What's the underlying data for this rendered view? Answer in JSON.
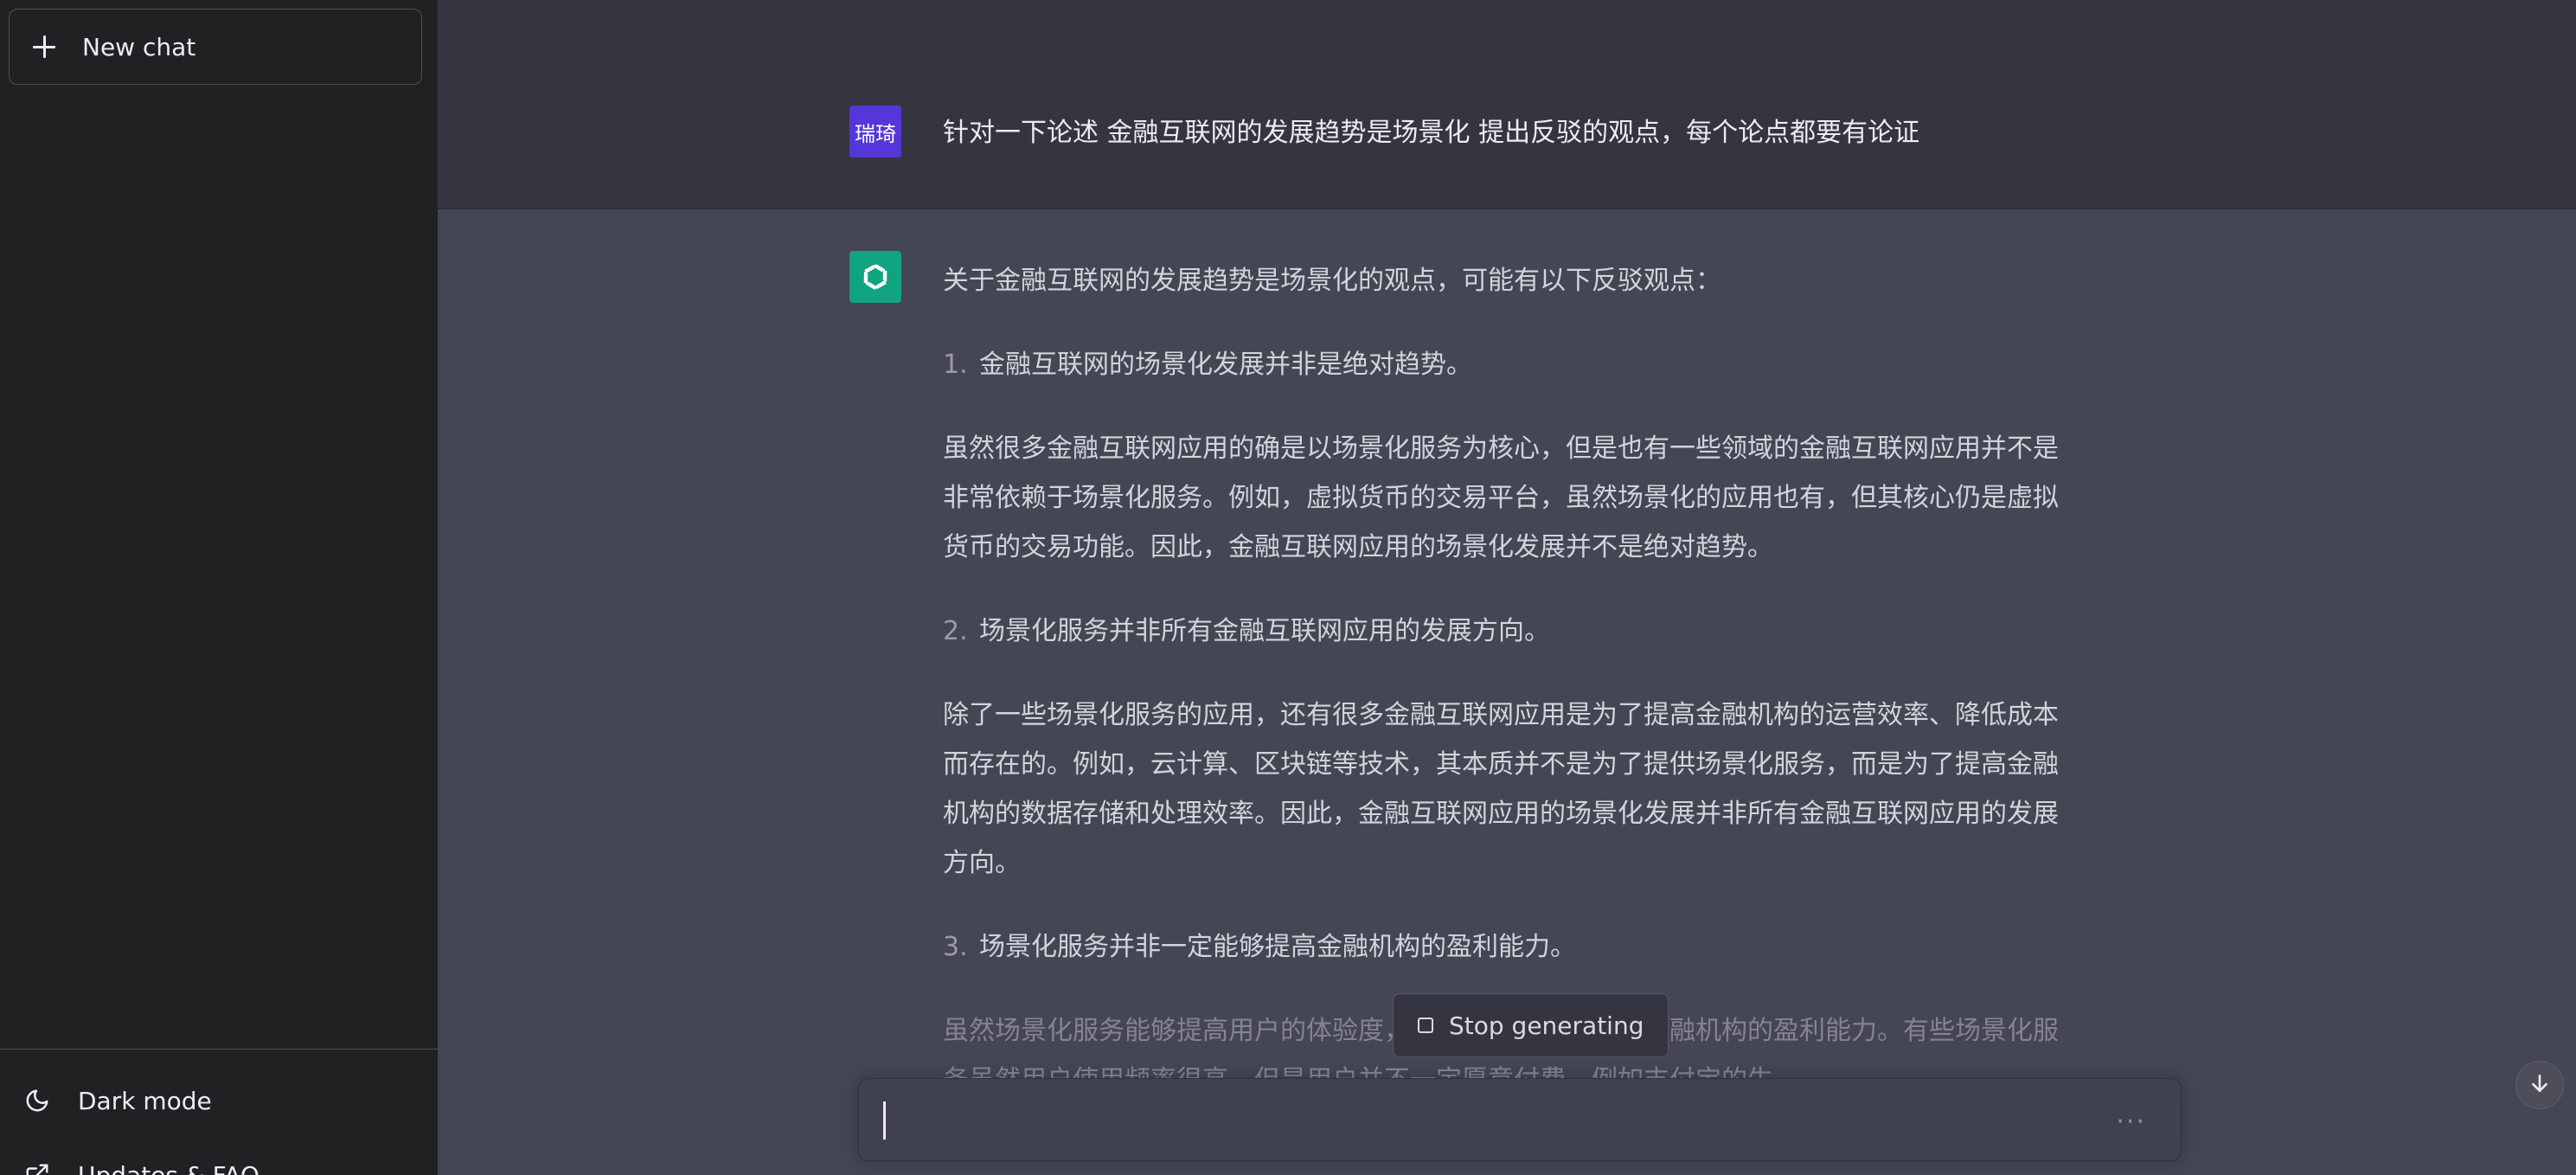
{
  "sidebar": {
    "new_chat_label": "New chat",
    "bottom_items": [
      {
        "label": "Dark mode",
        "icon": "moon-icon"
      },
      {
        "label": "Updates & FAQ",
        "icon": "external-link-icon"
      }
    ]
  },
  "conversation": {
    "user": {
      "avatar_text": "瑞琦",
      "message": "针对一下论述 金融互联网的发展趋势是场景化 提出反驳的观点，每个论点都要有论证"
    },
    "assistant": {
      "icon": "openai-logo-icon",
      "intro": "关于金融互联网的发展趋势是场景化的观点，可能有以下反驳观点：",
      "points": [
        {
          "num": "1.",
          "title": "金融互联网的场景化发展并非是绝对趋势。",
          "body": "虽然很多金融互联网应用的确是以场景化服务为核心，但是也有一些领域的金融互联网应用并不是非常依赖于场景化服务。例如，虚拟货币的交易平台，虽然场景化的应用也有，但其核心仍是虚拟货币的交易功能。因此，金融互联网应用的场景化发展并不是绝对趋势。"
        },
        {
          "num": "2.",
          "title": "场景化服务并非所有金融互联网应用的发展方向。",
          "body": "除了一些场景化服务的应用，还有很多金融互联网应用是为了提高金融机构的运营效率、降低成本而存在的。例如，云计算、区块链等技术，其本质并不是为了提供场景化服务，而是为了提高金融机构的数据存储和处理效率。因此，金融互联网应用的场景化发展并非所有金融互联网应用的发展方向。"
        },
        {
          "num": "3.",
          "title": "场景化服务并非一定能够提高金融机构的盈利能力。",
          "body": "虽然场景化服务能够提高用户的体验度，但并不一定能够提高金融机构的盈利能力。有些场景化服务虽然用户使用频率很高，但是用户并不一定愿意付费，例如支付宝的生"
        }
      ]
    }
  },
  "controls": {
    "stop_label": "Stop generating",
    "composer_placeholder": "",
    "composer_more": "···",
    "scroll_down_icon": "arrow-down-icon"
  }
}
